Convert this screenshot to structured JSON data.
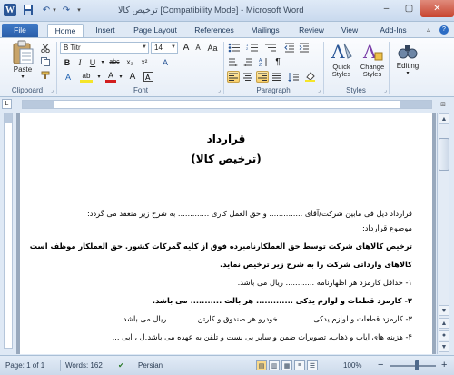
{
  "window": {
    "title": "ترخیص کالا [Compatibility Mode] - Microsoft Word",
    "minimize": "–",
    "maximize": "▢",
    "close": "✕"
  },
  "qat": {
    "word_icon": "W",
    "save_icon": "💾",
    "undo_icon": "↶",
    "redo_icon": "↷",
    "dropdown": "▾",
    "customize": "▾"
  },
  "tabs": [
    "File",
    "Home",
    "Insert",
    "Page Layout",
    "References",
    "Mailings",
    "Review",
    "View",
    "Add-Ins"
  ],
  "ribbon_controls": {
    "minimize": "▵",
    "help": "?"
  },
  "ribbon": {
    "clipboard": {
      "paste_label": "Paste",
      "group_label": "Clipboard"
    },
    "font": {
      "font_name": "B Titr",
      "font_size": "14",
      "grow": "A",
      "shrink": "A",
      "aa": "Aa",
      "clear": "A",
      "bold": "B",
      "italic": "I",
      "underline": "U",
      "strike": "abc",
      "sub": "x₂",
      "sup": "x²",
      "effects": "A",
      "highlight": "ab",
      "color": "A",
      "size_a": "A",
      "group_label": "Font"
    },
    "paragraph": {
      "show_marks": "¶",
      "group_label": "Paragraph"
    },
    "styles": {
      "quick_styles": "Quick Styles",
      "change_styles": "Change Styles",
      "group_label": "Styles"
    },
    "editing": {
      "label": "Editing"
    }
  },
  "ruler": {
    "tab_marker": "L",
    "view_ruler": "⊞"
  },
  "document": {
    "title": "قرارداد",
    "subtitle": "(ترخیص کالا)",
    "lines": [
      "قرارداد ذیل فی مابین شرکت/آقای .............. و حق العمل کاری ............. به شرح زیر منعقد می گردد:",
      "موضوع قرارداد:",
      "ترخیص کالاهای شرکت توسط حق العملکارنامبرده فوق از کلیه گمرکات کشور. حق العملکار موظف است",
      "کالاهای وارداتی شرکت را به شرح زیر ترخیص نماید.",
      "۱- حداقل کارمزد هر اظهارنامه ............ ریال می باشد.",
      "۲- کارمزد قطعات و لوازم یدکی ............. هر بالت ........... می باشد.",
      "۳- کارمزد قطعات و لوازم یدکی ............. خودرو هر صندوق و کارتن............ ریال می باشد.",
      "۴- هزینه های ایاب و ذهاب، تصویرات ضمن و سایر بی بست و تلفن به عهده می باشد.ل ، ابی ..."
    ]
  },
  "scrollbar": {
    "up": "▲",
    "down": "▼",
    "prev_page": "▲",
    "select_browse": "●",
    "next_page": "▼"
  },
  "status": {
    "page": "Page: 1 of 1",
    "words": "Words: 162",
    "proofing_icon": "✔",
    "language": "Persian",
    "zoom": "100%",
    "zoom_minus": "−",
    "zoom_plus": "+"
  },
  "zoom_level": 1.0,
  "colors": {
    "accent": "#2b5797",
    "file_tab": "#2a5ea8",
    "ribbon_bg": "#e7eef7"
  }
}
